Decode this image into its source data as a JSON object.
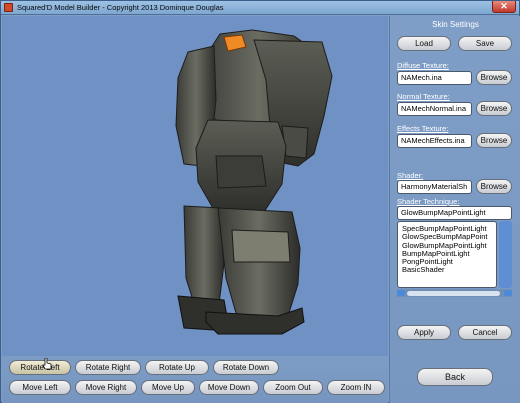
{
  "window": {
    "title": "Squared'D Model Builder - Copyright 2013 Dominque Douglas",
    "close_glyph": "✕"
  },
  "colors": {
    "viewport_bg": "#6f91c4",
    "panel_bg": "#7f9ec7",
    "scroll_accent": "#5f8fd2"
  },
  "skin_settings": {
    "title": "Skin Settings",
    "load_label": "Load",
    "save_label": "Save",
    "diffuse": {
      "label": "Diffuse Texture:",
      "value": "NAMech.ina",
      "browse_label": "Browse"
    },
    "normal": {
      "label": "Normal Texture:",
      "value": "NAMechNormal.ina",
      "browse_label": "Browse"
    },
    "effects": {
      "label": "Effects Texture:",
      "value": "NAMechEffects.ina",
      "browse_label": "Browse"
    },
    "shader": {
      "label": "Shader:",
      "value": "HarmonyMaterialSh",
      "browse_label": "Browse"
    },
    "technique": {
      "label": "Shader Technique:",
      "value": "GlowBumpMapPointLight",
      "options": [
        "SpecBumpMapPointLight",
        "GlowSpecBumpMapPoint",
        "GlowBumpMapPointLight",
        "BumpMapPointLight",
        "PongPointLight",
        "BasicShader"
      ]
    },
    "apply_label": "Apply",
    "cancel_label": "Cancel",
    "back_label": "Back"
  },
  "controls": {
    "row1": [
      "Rotate Left",
      "Rotate Right",
      "Rotate Up",
      "Rotate Down"
    ],
    "row2": [
      "Move Left",
      "Move Right",
      "Move Up",
      "Move Down",
      "Zoom Out",
      "Zoom IN"
    ]
  }
}
